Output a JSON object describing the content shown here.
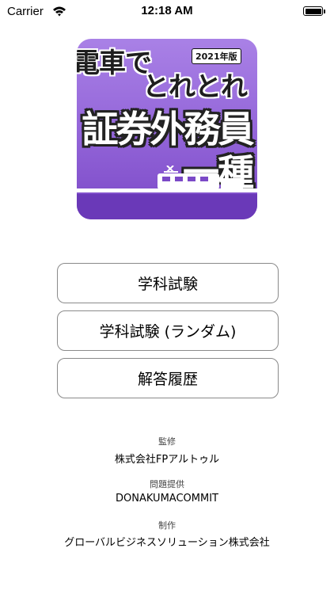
{
  "status_bar": {
    "carrier": "Carrier",
    "time": "12:18 AM",
    "battery_level": 1.0
  },
  "app_icon": {
    "line1": "電車で",
    "line2": "とれとれ",
    "year_badge": "2021年版",
    "line3": "証券外務員",
    "line4": "一種",
    "icon": "train-icon",
    "colors": {
      "background": "#9466d9",
      "rail": "#6a39b8"
    }
  },
  "menu": {
    "items": [
      {
        "label": "学科試験"
      },
      {
        "label": "学科試験 (ランダム)"
      },
      {
        "label": "解答履歴"
      }
    ]
  },
  "credits": {
    "supervision_label": "監修",
    "supervision_value": "株式会社FPアルトゥル",
    "questions_label": "問題提供",
    "questions_value": "DONAKUMACOMMIT",
    "production_label": "制作",
    "production_value": "グローバルビジネスソリューション株式会社"
  }
}
